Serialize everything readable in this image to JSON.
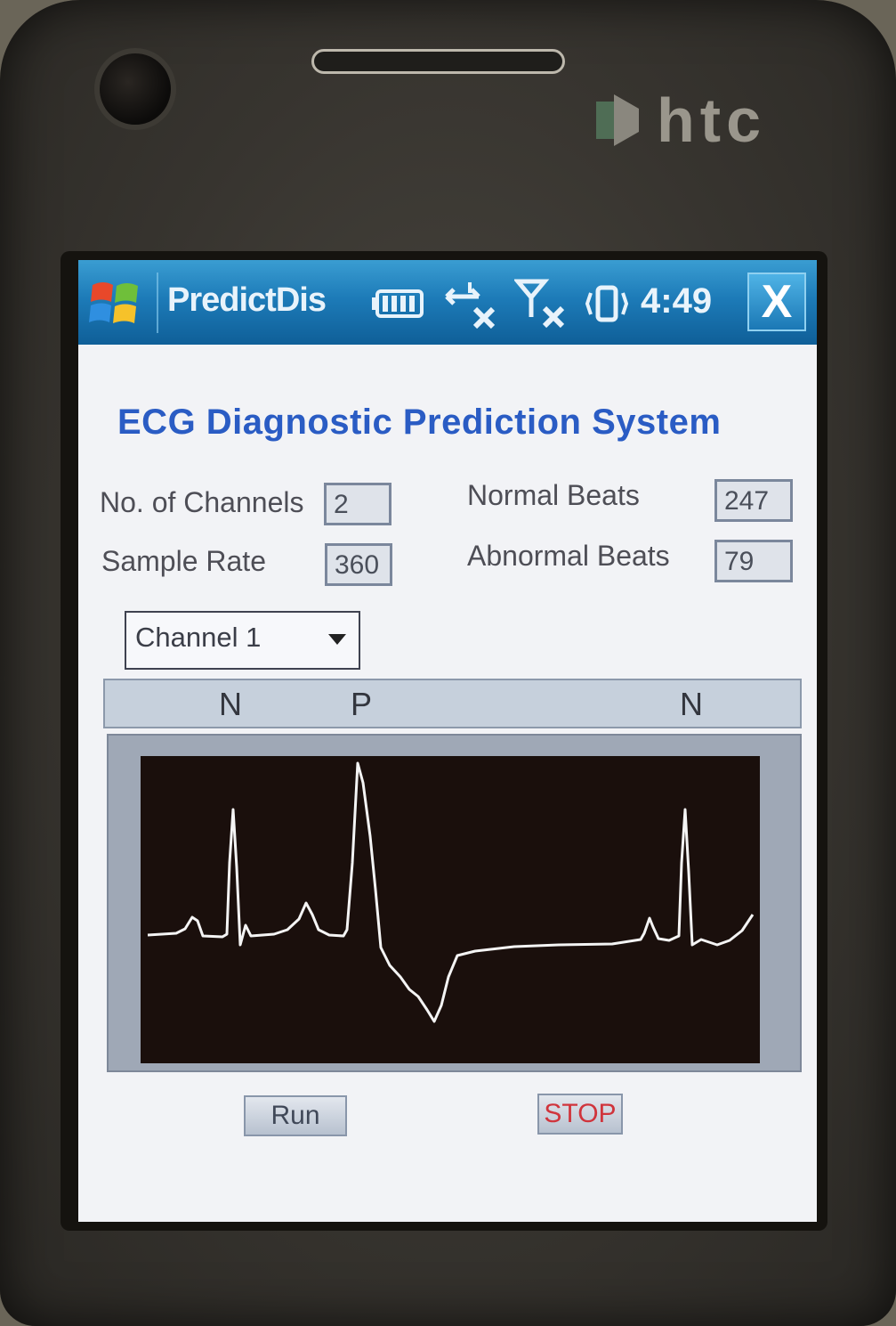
{
  "device": {
    "brand": "htc"
  },
  "titlebar": {
    "app_title": "PredictDis",
    "time": "4:49",
    "close_label": "X",
    "accent": "#1d7bb8"
  },
  "heading": "ECG Diagnostic Prediction System",
  "fields": {
    "channels_label": "No. of Channels",
    "channels_value": "2",
    "sample_rate_label": "Sample Rate",
    "sample_rate_value": "360",
    "normal_beats_label": "Normal Beats",
    "normal_beats_value": "247",
    "abnormal_beats_label": "Abnormal Beats",
    "abnormal_beats_value": "79"
  },
  "channel_select": {
    "selected": "Channel 1"
  },
  "beat_labels": [
    "N",
    "P",
    "N"
  ],
  "buttons": {
    "run_label": "Run",
    "stop_label": "STOP",
    "stop_color": "#d0343c"
  },
  "waveform": {
    "trace_color": "#f4f4f4",
    "background": "#1a0f0c"
  }
}
